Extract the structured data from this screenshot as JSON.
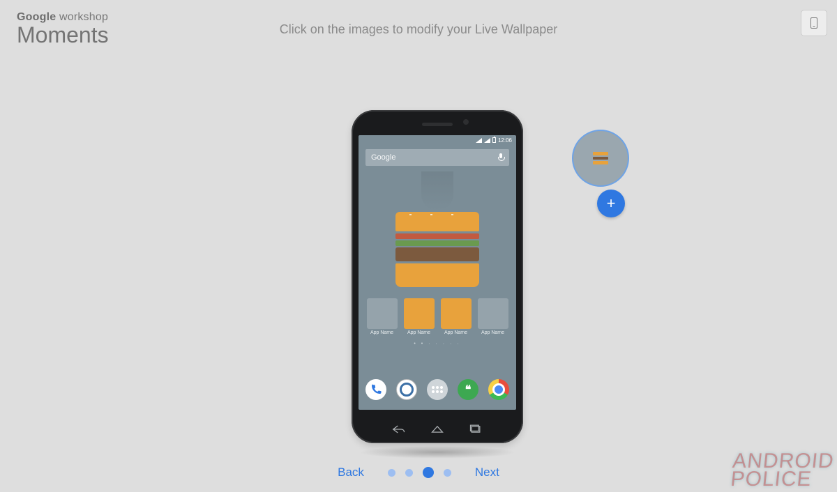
{
  "brand": {
    "prefix": "Google",
    "suffix": "workshop",
    "title": "Moments"
  },
  "instruction": "Click on the images to modify your Live Wallpaper",
  "status_time": "12:06",
  "search_placeholder": "Google",
  "app_label": "App Name",
  "footer": {
    "back": "Back",
    "next": "Next",
    "step_count": 4,
    "active_step": 3
  },
  "add_symbol": "+",
  "watermark": {
    "l1": "ANDROID",
    "l2": "POLICE"
  }
}
